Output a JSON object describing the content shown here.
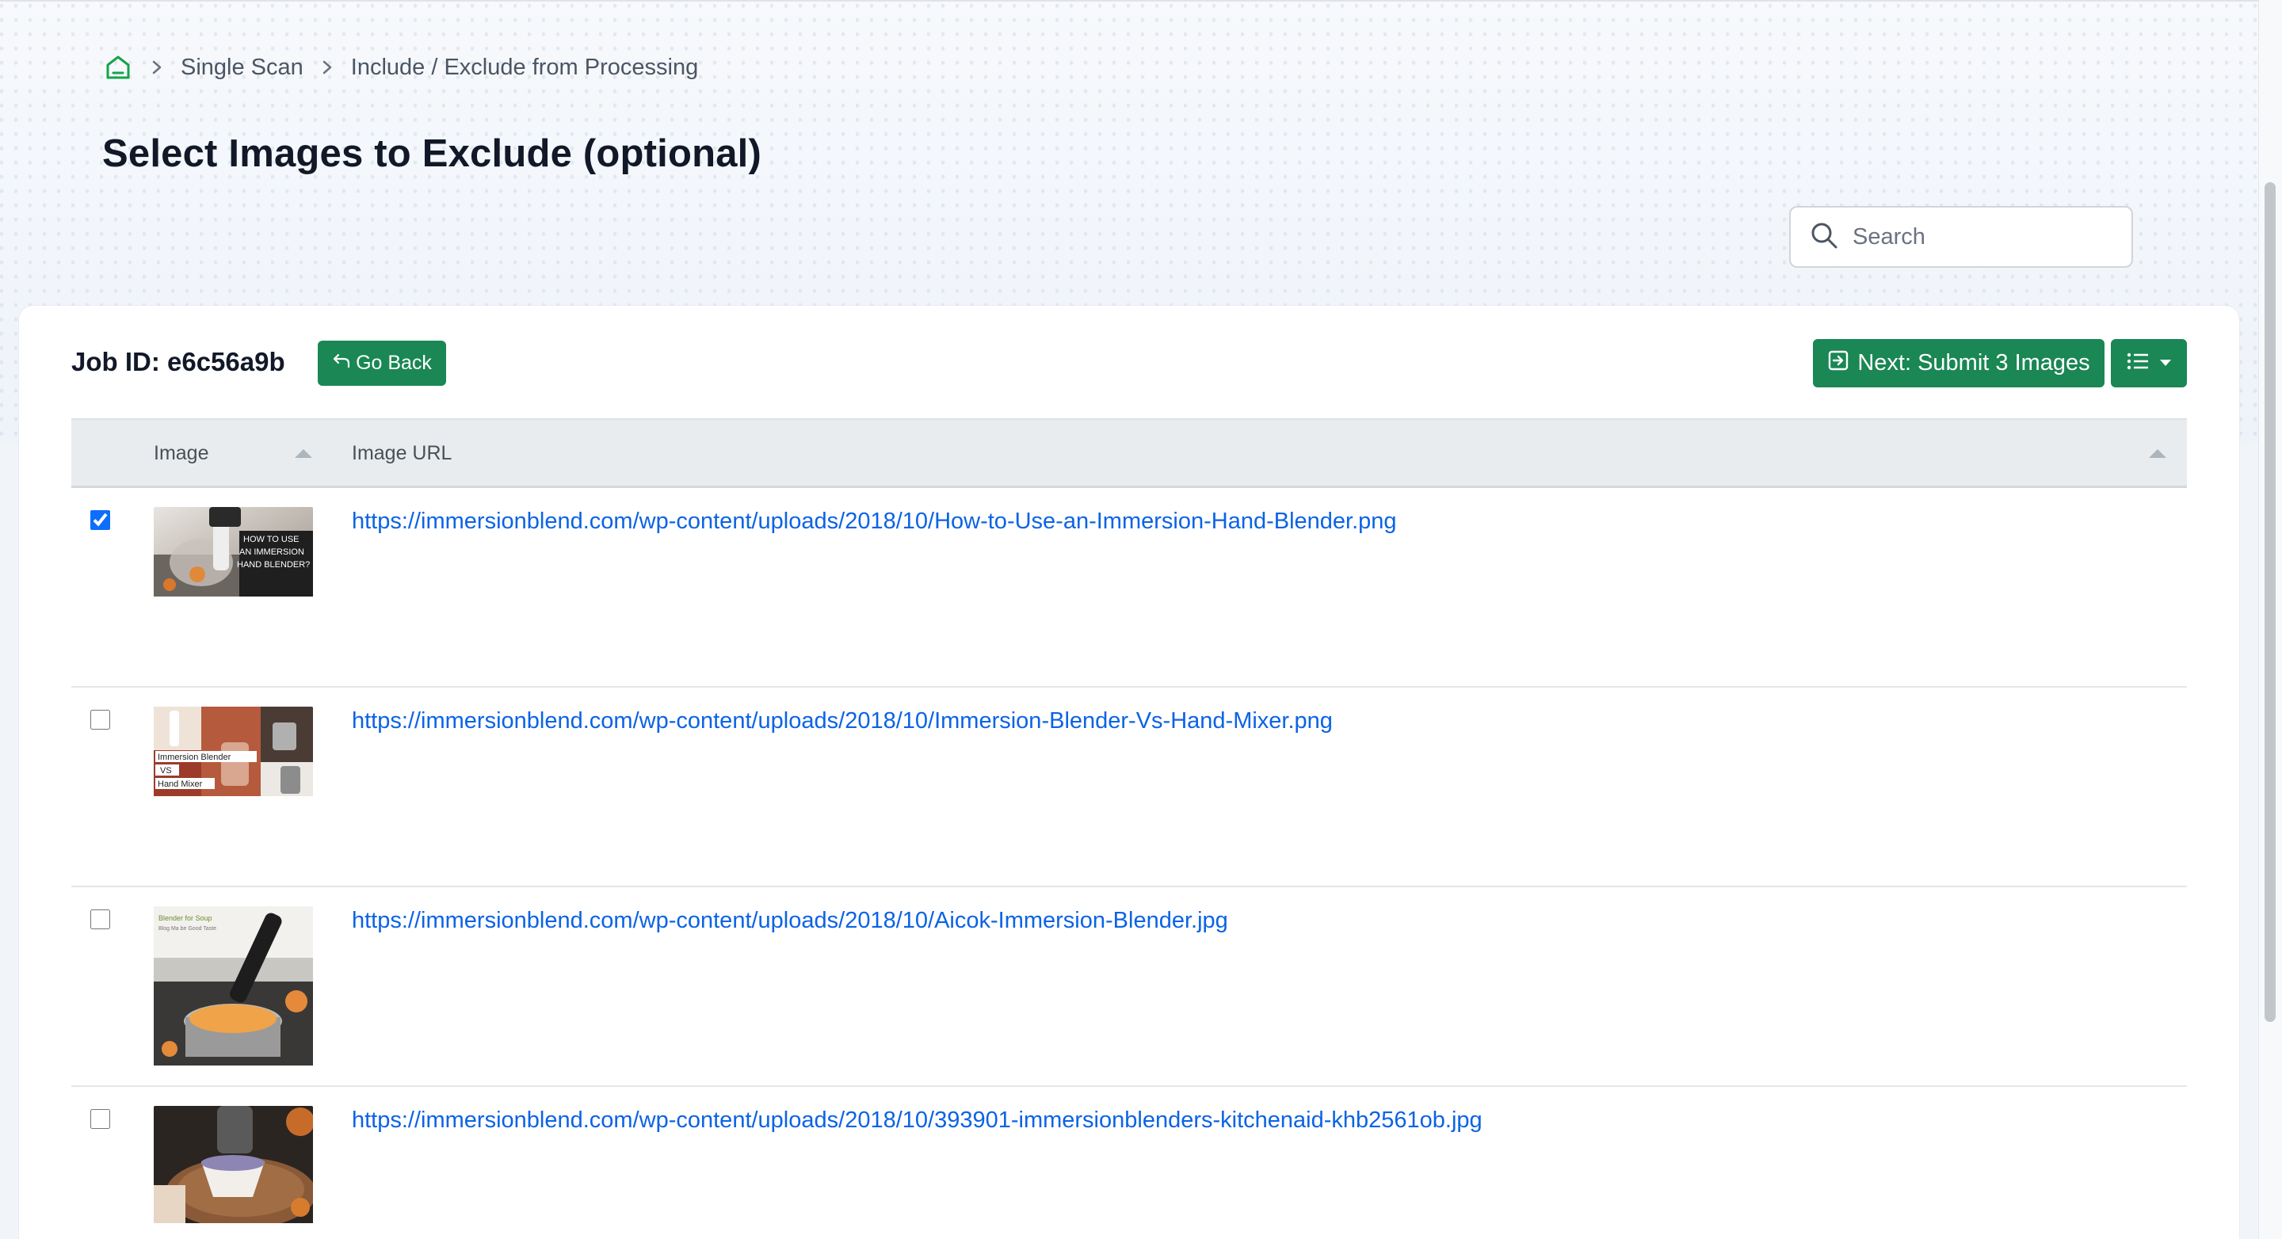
{
  "breadcrumb": {
    "home_icon": "home-icon",
    "items": [
      "Single Scan"
    ],
    "current": "Include / Exclude from Processing"
  },
  "page": {
    "title": "Select Images to Exclude (optional)"
  },
  "search": {
    "placeholder": "Search",
    "value": ""
  },
  "job": {
    "label": "Job ID: e6c56a9b"
  },
  "toolbar": {
    "go_back_label": "Go Back",
    "next_label": "Next: Submit 3 Images",
    "menu_icon": "list-icon"
  },
  "table": {
    "columns": [
      "Image",
      "Image URL"
    ],
    "rows": [
      {
        "checked": true,
        "url": "https://immersionblend.com/wp-content/uploads/2018/10/How-to-Use-an-Immersion-Hand-Blender.png",
        "thumb_text": [
          "HOW TO USE",
          "AN IMMERSION",
          "HAND BLENDER?"
        ]
      },
      {
        "checked": false,
        "url": "https://immersionblend.com/wp-content/uploads/2018/10/Immersion-Blender-Vs-Hand-Mixer.png",
        "thumb_text": [
          "Immersion Blender",
          "VS",
          "Hand Mixer"
        ]
      },
      {
        "checked": false,
        "url": "https://immersionblend.com/wp-content/uploads/2018/10/Aicok-Immersion-Blender.jpg",
        "thumb_text": [
          "Blender for Soup",
          "Blog Ma be Good Taste"
        ]
      },
      {
        "checked": false,
        "url": "https://immersionblend.com/wp-content/uploads/2018/10/393901-immersionblenders-kitchenaid-khb2561ob.jpg",
        "thumb_text": []
      }
    ]
  },
  "colors": {
    "accent_green": "#1a8754",
    "link_blue": "#0b63e5",
    "home_icon_green": "#16a34a"
  }
}
